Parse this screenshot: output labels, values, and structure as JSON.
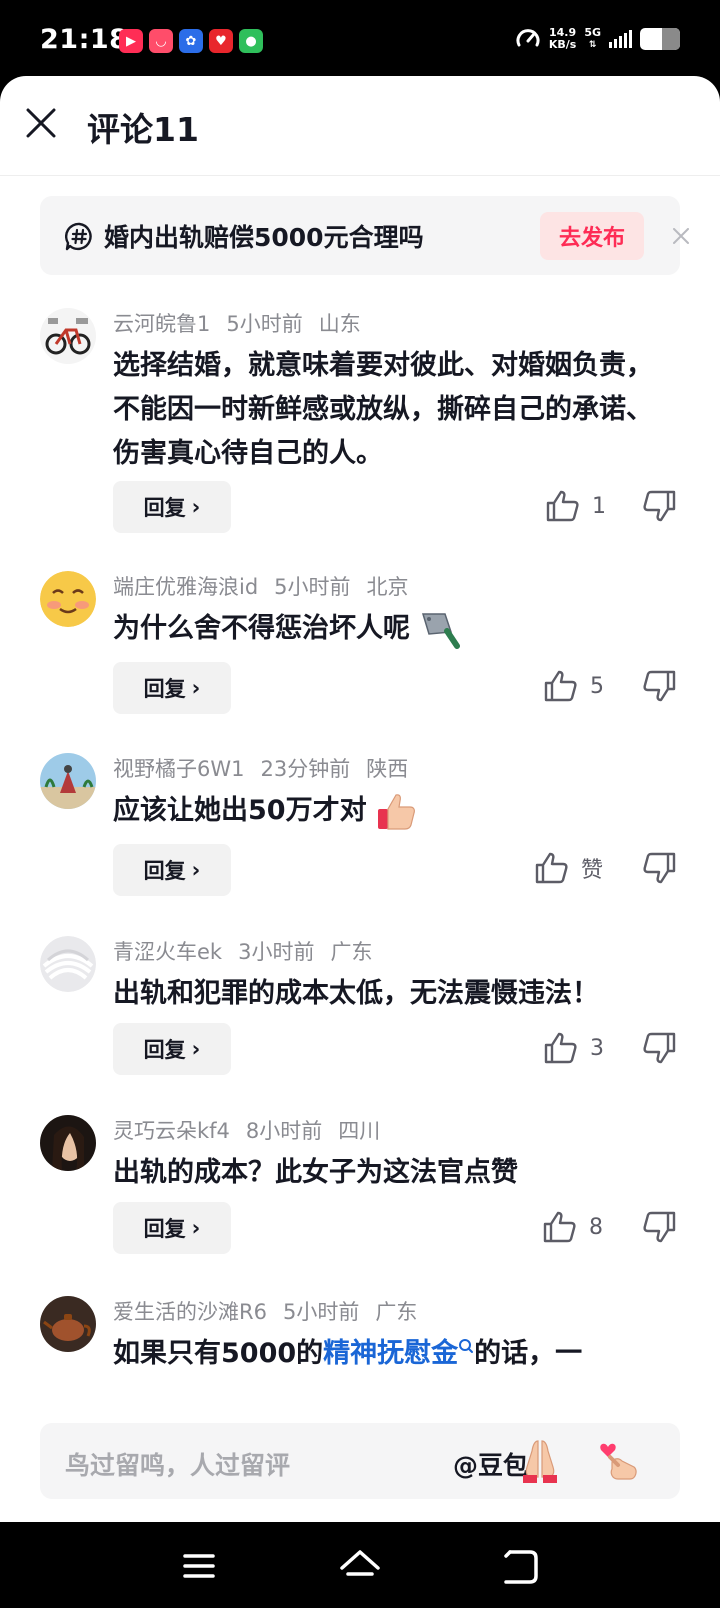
{
  "status": {
    "time": "21:18",
    "speed_value": "14.9",
    "speed_unit": "KB/s",
    "network": "5G",
    "battery_level": 0.55,
    "app_icons": [
      "video-app-icon",
      "tv-app-icon",
      "baidu-app-icon",
      "red-app-icon",
      "wechat-app-icon"
    ]
  },
  "header": {
    "title": "评论11"
  },
  "topic": {
    "text": "婚内出轨赔偿5000元合理吗",
    "action_label": "去发布"
  },
  "comments": [
    {
      "username": "云河皖鲁1",
      "time": "5小时前",
      "location": "山东",
      "text": "选择结婚，就意味着要对彼此、对婚姻负责，不能因一时新鲜感或放纵，撕碎自己的承诺、伤害真心待自己的人。",
      "reply_label": "回复",
      "likes": "1",
      "avatar": "bicycle-avatar"
    },
    {
      "username": "端庄优雅海浪id",
      "time": "5小时前",
      "location": "北京",
      "text": "为什么舍不得惩治坏人呢",
      "emoji": "cleaver-emoji",
      "reply_label": "回复",
      "likes": "5",
      "avatar": "smiley-avatar"
    },
    {
      "username": "视野橘子6W1",
      "time": "23分钟前",
      "location": "陕西",
      "text": "应该让她出50万才对",
      "emoji": "thumbs-up-emoji",
      "reply_label": "回复",
      "likes": "赞",
      "avatar": "beach-avatar"
    },
    {
      "username": "青涩火车ek",
      "time": "3小时前",
      "location": "广东",
      "text": "出轨和犯罪的成本太低，无法震慑违法！",
      "reply_label": "回复",
      "likes": "3",
      "avatar": "abstract-avatar"
    },
    {
      "username": "灵巧云朵kf4",
      "time": "8小时前",
      "location": "四川",
      "text": "出轨的成本？此女子为这法官点赞",
      "reply_label": "回复",
      "likes": "8",
      "avatar": "woman-avatar"
    },
    {
      "username": "爱生活的沙滩R6",
      "time": "5小时前",
      "location": "广东",
      "text_before": "如果只有5000的",
      "link_text": "精神抚慰金",
      "text_after": "的话，一",
      "avatar": "teapot-avatar"
    }
  ],
  "input": {
    "placeholder": "鸟过留鸣，人过留评",
    "mention": "@豆包"
  },
  "colors": {
    "accent": "#fe2c55",
    "link": "#1a66d6",
    "meta": "#8a8b91"
  }
}
